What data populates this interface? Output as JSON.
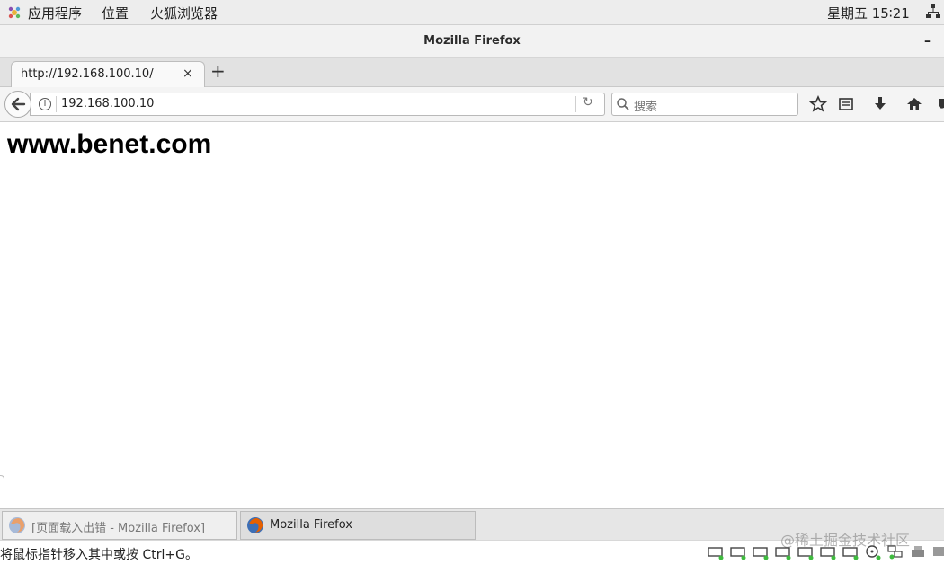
{
  "topbar": {
    "apps_label": "应用程序",
    "places_label": "位置",
    "firefox_label": "火狐浏览器",
    "clock": "星期五 15∶21"
  },
  "window": {
    "title": "Mozilla Firefox",
    "minimize_label": "–"
  },
  "tabs": [
    {
      "label": "http://192.168.100.10/",
      "close_label": "×"
    }
  ],
  "new_tab_label": "+",
  "navbar": {
    "url": "192.168.100.10",
    "search_placeholder": "搜索"
  },
  "content": {
    "heading": "www.benet.com"
  },
  "taskbar": [
    {
      "label": "[页面载入出错 - Mozilla Firefox]",
      "active": false
    },
    {
      "label": "Mozilla Firefox",
      "active": true
    }
  ],
  "statusbar": {
    "hint": "将鼠标指针移入其中或按 Ctrl+G。",
    "watermark": "@稀土掘金技术社区"
  },
  "colors": {
    "accent_orange": "#e66000",
    "firefox_blue": "#3d6fb6",
    "status_green": "#3fbb3f"
  }
}
